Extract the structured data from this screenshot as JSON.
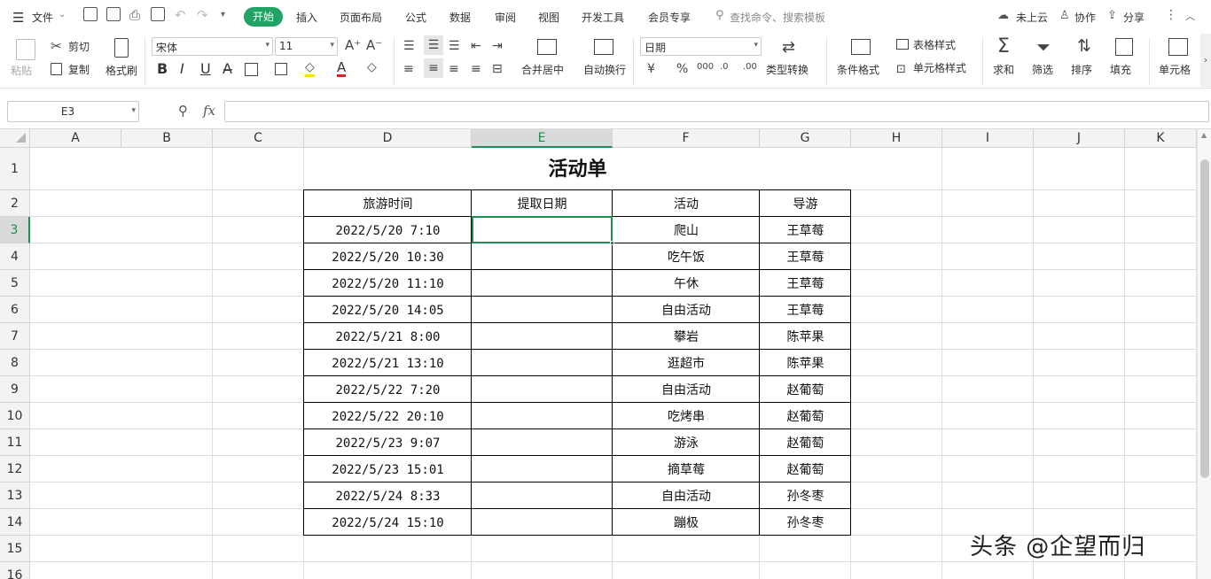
{
  "menu": {
    "file": "文件",
    "tabs": [
      "开始",
      "插入",
      "页面布局",
      "公式",
      "数据",
      "审阅",
      "视图",
      "开发工具",
      "会员专享"
    ],
    "search": "查找命令、搜索模板",
    "cloud": "未上云",
    "collab": "协作",
    "share": "分享"
  },
  "ribbon": {
    "paste": "粘贴",
    "cut": "剪切",
    "copy": "复制",
    "format_painter": "格式刷",
    "font_name": "宋体",
    "font_size": "11",
    "merge": "合并居中",
    "wrap": "自动换行",
    "number_format": "日期",
    "type_convert": "类型转换",
    "cond_format": "条件格式",
    "table_style": "表格样式",
    "cell_style": "单元格样式",
    "sum": "求和",
    "filter": "筛选",
    "sort": "排序",
    "fill": "填充",
    "cell": "单元格"
  },
  "formula_bar": {
    "cell_ref": "E3",
    "fx": "fx",
    "value": ""
  },
  "columns": [
    "A",
    "B",
    "C",
    "D",
    "E",
    "F",
    "G",
    "H",
    "I",
    "J",
    "K"
  ],
  "rows": [
    "1",
    "2",
    "3",
    "4",
    "5",
    "6",
    "7",
    "8",
    "9",
    "10",
    "11",
    "12",
    "13",
    "14",
    "15",
    "16"
  ],
  "active_cell": "E3",
  "sheet": {
    "title": "活动单",
    "headers": [
      "旅游时间",
      "提取日期",
      "活动",
      "导游"
    ],
    "data": [
      [
        "2022/5/20 7:10",
        "",
        "爬山",
        "王草莓"
      ],
      [
        "2022/5/20 10:30",
        "",
        "吃午饭",
        "王草莓"
      ],
      [
        "2022/5/20 11:10",
        "",
        "午休",
        "王草莓"
      ],
      [
        "2022/5/20 14:05",
        "",
        "自由活动",
        "王草莓"
      ],
      [
        "2022/5/21 8:00",
        "",
        "攀岩",
        "陈苹果"
      ],
      [
        "2022/5/21 13:10",
        "",
        "逛超市",
        "陈苹果"
      ],
      [
        "2022/5/22 7:20",
        "",
        "自由活动",
        "赵葡萄"
      ],
      [
        "2022/5/22 20:10",
        "",
        "吃烤串",
        "赵葡萄"
      ],
      [
        "2022/5/23 9:07",
        "",
        "游泳",
        "赵葡萄"
      ],
      [
        "2022/5/23 15:01",
        "",
        "摘草莓",
        "赵葡萄"
      ],
      [
        "2022/5/24 8:33",
        "",
        "自由活动",
        "孙冬枣"
      ],
      [
        "2022/5/24 15:10",
        "",
        "蹦极",
        "孙冬枣"
      ]
    ]
  },
  "watermark": "头条 @企望而归",
  "colors": {
    "accent": "#21a366",
    "selected": "#1e8e4f"
  }
}
